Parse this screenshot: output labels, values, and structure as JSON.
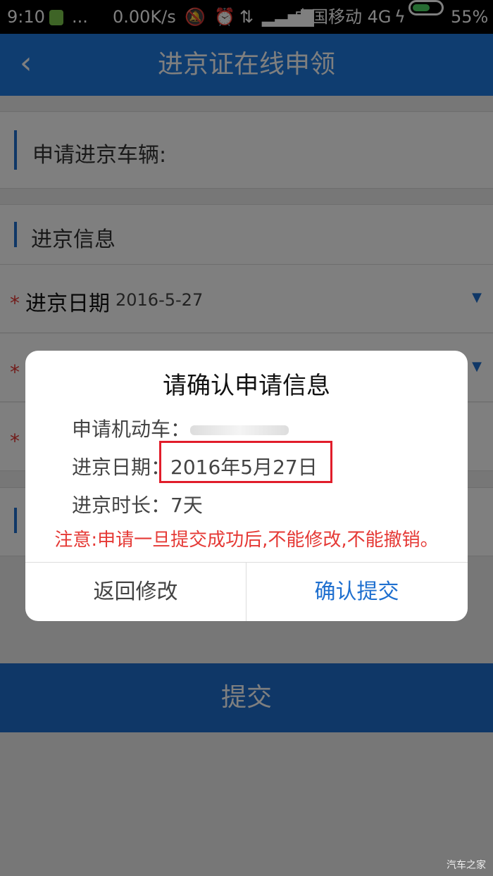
{
  "status_bar": {
    "time": "9:10",
    "more": "...",
    "speed": "0.00K/s",
    "carrier": "中国移动 4G",
    "battery": "55%",
    "icons": [
      "wechat-icon",
      "vibrate-off-icon",
      "alarm-icon",
      "data-arrows-icon",
      "signal-icon",
      "charging-icon",
      "battery-icon"
    ]
  },
  "titlebar": {
    "back": "‹",
    "title": "进京证在线申领"
  },
  "vehicle_section": {
    "label": "申请进京车辆:"
  },
  "info_section": {
    "label": "进京信息"
  },
  "form": {
    "date_label": "进京日期",
    "date_value": "2016-5-27",
    "required_mark": "*",
    "caret": "▼"
  },
  "submit_label": "提交",
  "dialog": {
    "title": "请确认申请信息",
    "vehicle_label": "申请机动车：",
    "date_label": "进京日期：",
    "date_value": "2016年5月27日",
    "duration_label": "进京时长：",
    "duration_value": "7天",
    "warning": "注意:申请一旦提交成功后,不能修改,不能撤销。",
    "back_button": "返回修改",
    "confirm_button": "确认提交"
  },
  "watermark": "汽车之家",
  "colors": {
    "primary": "#1e7be0",
    "danger": "#e53935",
    "highlight_box": "#e11d2a"
  }
}
